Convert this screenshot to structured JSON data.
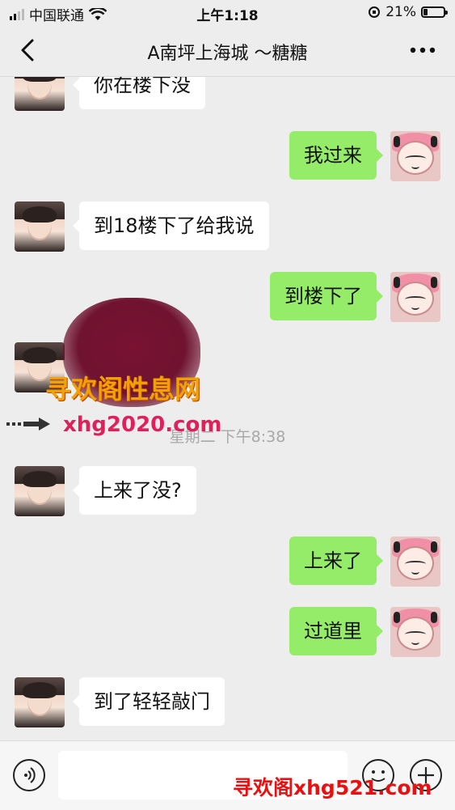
{
  "status_bar": {
    "carrier": "中国联通",
    "time": "上午1:18",
    "battery_percent": "21%",
    "battery_level": 0.21
  },
  "nav": {
    "title": "A南坪上海城 ～糖糖",
    "back_icon": "chevron-left-icon",
    "more_icon": "more-dots-icon"
  },
  "messages": [
    {
      "side": "in",
      "text": "你在楼下没"
    },
    {
      "side": "out",
      "text": "我过来"
    },
    {
      "side": "in",
      "text": "到18楼下了给我说"
    },
    {
      "side": "out",
      "text": "到楼下了"
    },
    {
      "side": "in",
      "text": ""
    },
    {
      "side": "in",
      "text": "上来了没?"
    },
    {
      "side": "out",
      "text": "上来了"
    },
    {
      "side": "out",
      "text": "过道里"
    },
    {
      "side": "in",
      "text": "到了轻轻敲门"
    }
  ],
  "timestamp": "星期二 下午8:38",
  "watermarks": {
    "top": "寻欢阁性息网",
    "middle": "xhg2020.com",
    "bottom": "寻欢阁xhg521.com"
  },
  "input_bar": {
    "voice_icon": "voice-icon",
    "emoji_icon": "emoji-icon",
    "add_icon": "plus-circle-icon"
  },
  "colors": {
    "outgoing_bubble": "#95ec69",
    "incoming_bubble": "#ffffff",
    "background": "#ededed"
  }
}
